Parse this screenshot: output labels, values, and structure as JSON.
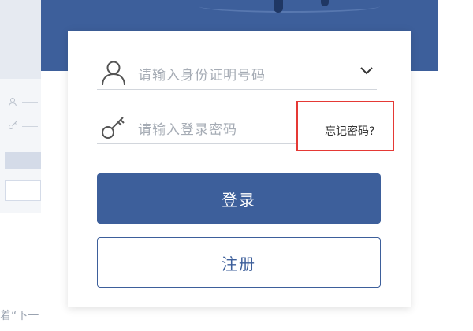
{
  "login_form": {
    "id_placeholder": "请输入身份证明号码",
    "password_placeholder": "请输入登录密码",
    "forgot_password": "忘记密码?",
    "login_button": "登录",
    "register_button": "注册"
  },
  "background": {
    "partial_text": "着“下一"
  },
  "icons": {
    "user": "user-icon",
    "key": "key-icon",
    "dropdown": "chevron-down-icon"
  },
  "colors": {
    "primary": "#3d5f9b",
    "highlight": "#e53935"
  }
}
